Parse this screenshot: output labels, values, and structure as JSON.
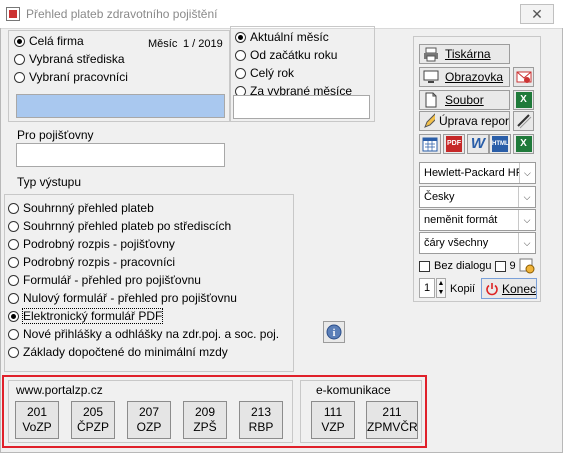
{
  "window": {
    "title": "Přehled plateb zdravotního pojištění",
    "close_glyph": "✕"
  },
  "scope": {
    "options": [
      "Celá firma",
      "Vybraná střediska",
      "Vybraní pracovníci"
    ],
    "selected": 0,
    "month_label": "Měsíc",
    "month_value": "1 / 2019"
  },
  "period": {
    "options": [
      "Aktuální měsíc",
      "Od začátku roku",
      "Celý rok",
      "Za vybrané měsíce"
    ],
    "selected": 0
  },
  "insurer": {
    "label": "Pro pojišťovny",
    "value": ""
  },
  "output": {
    "label": "Typ výstupu",
    "options": [
      "Souhrnný přehled plateb",
      "Souhrnný přehled plateb po střediscích",
      "Podrobný rozpis - pojišťovny",
      "Podrobný rozpis - pracovníci",
      "Formulář - přehled pro pojišťovnu",
      "Nulový formulář - přehled pro pojišťovnu",
      "Elektronický formulář PDF",
      "Nové přihlášky a odhlášky na zdr.poj. a soc. poj.",
      "Základy dopočtené do minimální mzdy"
    ],
    "selected": 6
  },
  "actions": {
    "print": "Tiskárna",
    "screen": "Obrazovka",
    "file": "Soubor",
    "edit_report": "Úprava repor",
    "pdf": "PDF",
    "w": "W",
    "html": "HTML",
    "xls": "X"
  },
  "settings": {
    "printer": "Hewlett-Packard HP",
    "language": "Česky",
    "format": "neměnit formát",
    "lines": "čáry všechny",
    "no_dialog_label": "Bez dialogu",
    "dialog_number": "9",
    "copies_value": "1",
    "copies_label": "Kopií",
    "end_label": "Konec"
  },
  "portal": {
    "title": "www.portalzp.cz",
    "buttons": [
      {
        "code": "201",
        "name": "VoZP"
      },
      {
        "code": "205",
        "name": "ČPZP"
      },
      {
        "code": "207",
        "name": "OZP"
      },
      {
        "code": "209",
        "name": "ZPŠ"
      },
      {
        "code": "213",
        "name": "RBP"
      }
    ]
  },
  "ecom": {
    "title": "e-komunikace",
    "buttons": [
      {
        "code": "111",
        "name": "VZP"
      },
      {
        "code": "211",
        "name": "ZPMVČR"
      }
    ]
  },
  "colors": {
    "highlight_field": "#a9c8ef",
    "red_frame": "#e0202a",
    "end_icon": "#d22"
  }
}
